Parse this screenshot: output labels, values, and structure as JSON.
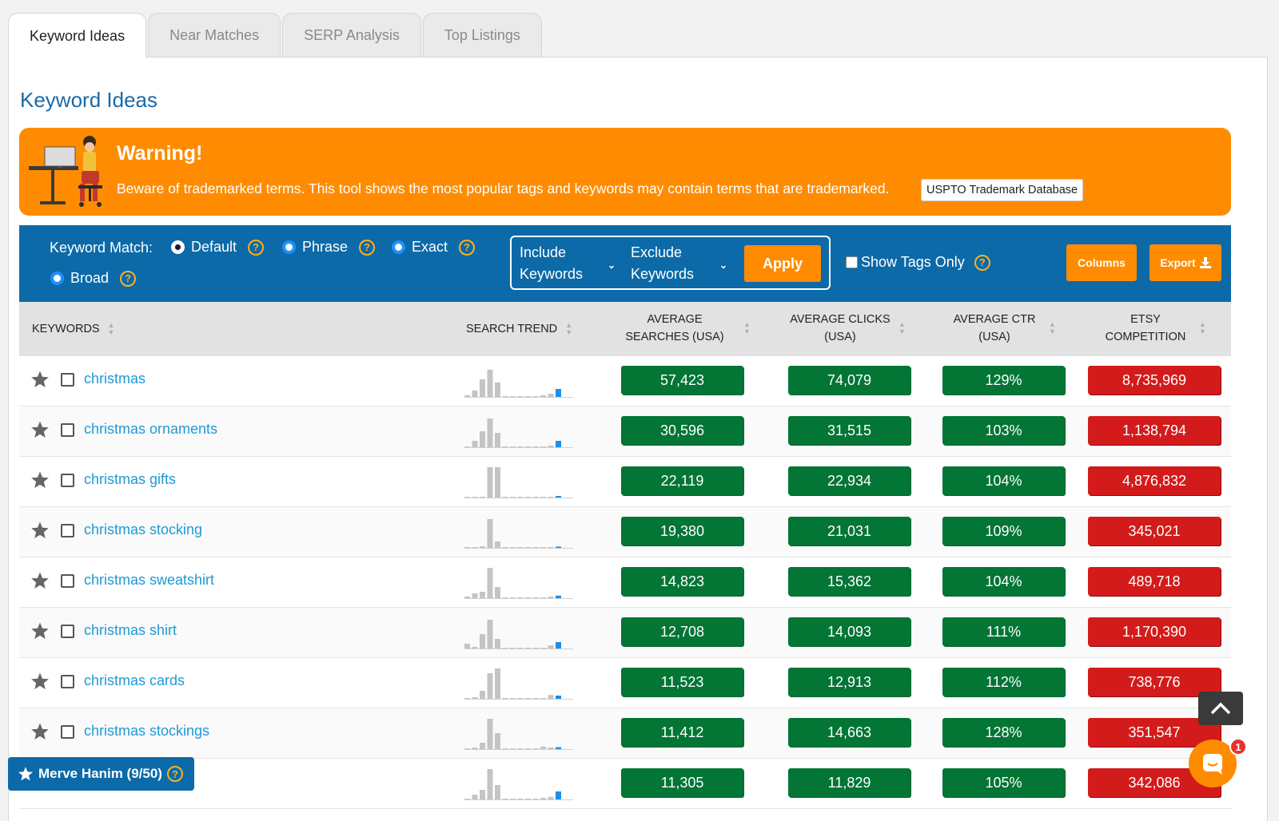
{
  "tabs": [
    {
      "label": "Keyword Ideas"
    },
    {
      "label": "Near Matches"
    },
    {
      "label": "SERP Analysis"
    },
    {
      "label": "Top Listings"
    }
  ],
  "page_title": "Keyword Ideas",
  "warning": {
    "title": "Warning!",
    "text": "Beware of trademarked terms. This tool shows the most popular tags and keywords may contain terms that are trademarked.",
    "link_label": "USPTO Trademark Database"
  },
  "filters": {
    "keyword_match_label": "Keyword Match:",
    "options": [
      "Default",
      "Phrase",
      "Exact",
      "Broad"
    ],
    "selected": "Default",
    "include_label": "Include Keywords",
    "exclude_label": "Exclude Keywords",
    "apply_label": "Apply",
    "show_tags_label": "Show Tags Only",
    "columns_label": "Columns",
    "export_label": "Export"
  },
  "table": {
    "headers": [
      "KEYWORDS",
      "SEARCH TREND",
      "AVERAGE SEARCHES (USA)",
      "AVERAGE CLICKS (USA)",
      "AVERAGE CTR (USA)",
      "ETSY COMPETITION"
    ],
    "rows": [
      {
        "keyword": "christmas",
        "searches": "57,423",
        "clicks": "74,079",
        "ctr": "129%",
        "competition": "8,735,969",
        "trend": [
          0.05,
          0.2,
          0.55,
          0.85,
          0.45,
          0.02,
          0.02,
          0.02,
          0.02,
          0.02,
          0.05,
          0.1,
          0.25
        ]
      },
      {
        "keyword": "christmas ornaments",
        "searches": "30,596",
        "clicks": "31,515",
        "ctr": "103%",
        "competition": "1,138,794",
        "trend": [
          0.02,
          0.2,
          0.5,
          0.9,
          0.45,
          0.02,
          0.02,
          0.02,
          0.02,
          0.02,
          0.02,
          0.05,
          0.2
        ]
      },
      {
        "keyword": "christmas gifts",
        "searches": "22,119",
        "clicks": "22,934",
        "ctr": "104%",
        "competition": "4,876,832",
        "trend": [
          0.02,
          0.02,
          0.02,
          0.95,
          0.95,
          0.02,
          0.02,
          0.02,
          0.02,
          0.02,
          0.02,
          0.02,
          0.05
        ]
      },
      {
        "keyword": "christmas stocking",
        "searches": "19,380",
        "clicks": "21,031",
        "ctr": "109%",
        "competition": "345,021",
        "trend": [
          0.02,
          0.02,
          0.05,
          0.9,
          0.2,
          0.02,
          0.02,
          0.02,
          0.02,
          0.02,
          0.02,
          0.02,
          0.04
        ]
      },
      {
        "keyword": "christmas sweatshirt",
        "searches": "14,823",
        "clicks": "15,362",
        "ctr": "104%",
        "competition": "489,718",
        "trend": [
          0.05,
          0.15,
          0.2,
          0.95,
          0.35,
          0.02,
          0.02,
          0.02,
          0.02,
          0.02,
          0.02,
          0.05,
          0.08
        ]
      },
      {
        "keyword": "christmas shirt",
        "searches": "12,708",
        "clicks": "14,093",
        "ctr": "111%",
        "competition": "1,170,390",
        "trend": [
          0.15,
          0.05,
          0.45,
          0.9,
          0.3,
          0.02,
          0.02,
          0.02,
          0.02,
          0.02,
          0.02,
          0.1,
          0.2
        ]
      },
      {
        "keyword": "christmas cards",
        "searches": "11,523",
        "clicks": "12,913",
        "ctr": "112%",
        "competition": "738,776",
        "trend": [
          0.02,
          0.05,
          0.25,
          0.8,
          0.95,
          0.02,
          0.02,
          0.02,
          0.02,
          0.02,
          0.02,
          0.12,
          0.1
        ]
      },
      {
        "keyword": "christmas stockings",
        "searches": "11,412",
        "clicks": "14,663",
        "ctr": "128%",
        "competition": "351,547",
        "trend": [
          0.02,
          0.05,
          0.2,
          0.95,
          0.5,
          0.02,
          0.02,
          0.02,
          0.02,
          0.02,
          0.08,
          0.05,
          0.06
        ]
      },
      {
        "keyword": "",
        "searches": "11,305",
        "clicks": "11,829",
        "ctr": "105%",
        "competition": "342,086",
        "trend": [
          0.02,
          0.15,
          0.3,
          0.95,
          0.45,
          0.02,
          0.02,
          0.02,
          0.02,
          0.02,
          0.05,
          0.08,
          0.25
        ]
      }
    ]
  },
  "user_badge": {
    "label": "Merve Hanim (9/50)"
  },
  "chat": {
    "unread": "1"
  },
  "colors": {
    "accent_orange": "#ff8c00",
    "bar_blue": "#0c6aa8",
    "good_green": "#037535",
    "bad_red": "#d31b1b",
    "link_blue": "#1f9ad6"
  }
}
